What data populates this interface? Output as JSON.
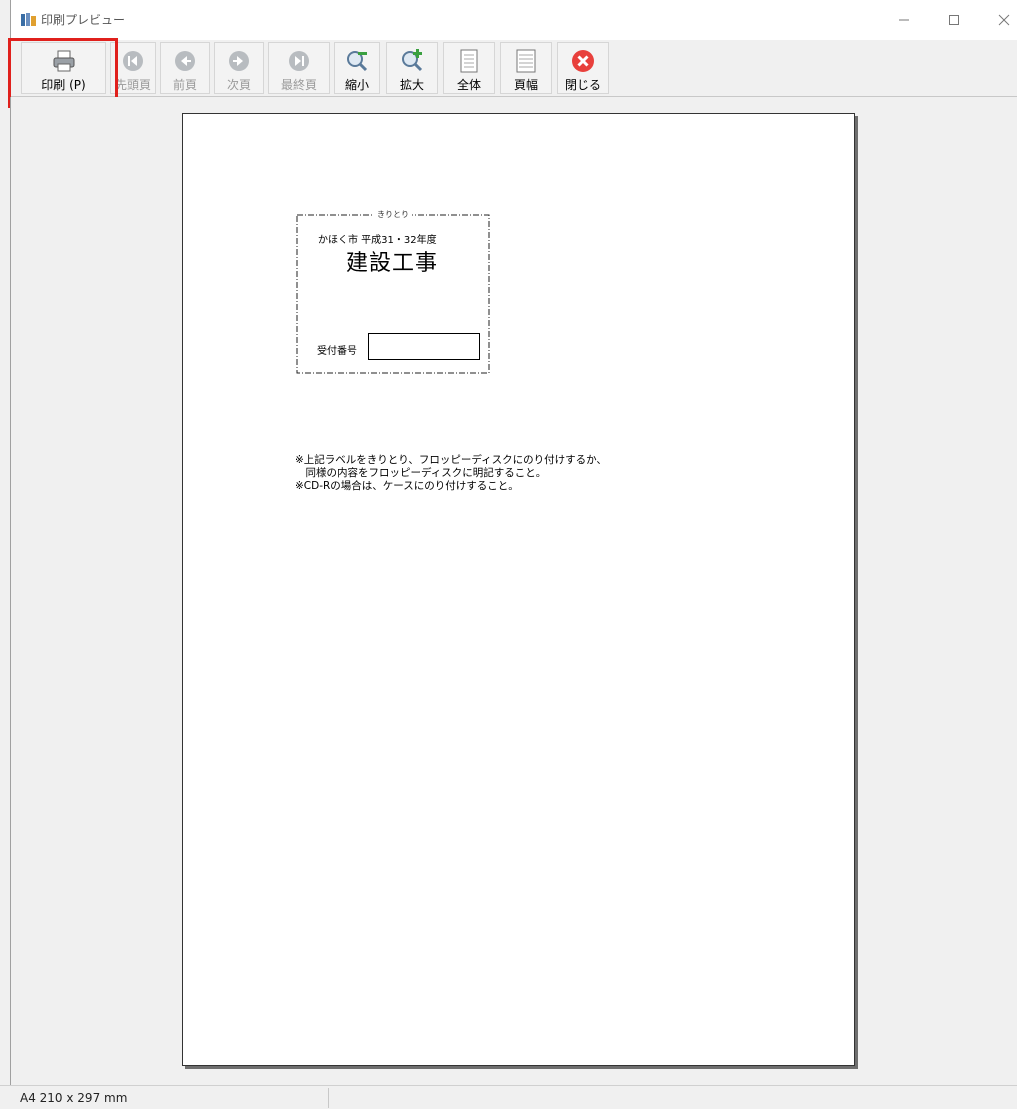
{
  "window": {
    "title": "印刷プレビュー"
  },
  "toolbar": {
    "buttons": [
      {
        "label": "印刷 (P)",
        "icon": "printer-icon",
        "enabled": true
      },
      {
        "label": "先頭頁",
        "icon": "first-page-icon",
        "enabled": false
      },
      {
        "label": "前頁",
        "icon": "prev-page-icon",
        "enabled": false
      },
      {
        "label": "次頁",
        "icon": "next-page-icon",
        "enabled": false
      },
      {
        "label": "最終頁",
        "icon": "last-page-icon",
        "enabled": false
      },
      {
        "label": "縮小",
        "icon": "zoom-out-icon",
        "enabled": true
      },
      {
        "label": "拡大",
        "icon": "zoom-in-icon",
        "enabled": true
      },
      {
        "label": "全体",
        "icon": "whole-page-icon",
        "enabled": true
      },
      {
        "label": "頁幅",
        "icon": "page-width-icon",
        "enabled": true
      },
      {
        "label": "閉じる",
        "icon": "close-red-icon",
        "enabled": true
      }
    ]
  },
  "page": {
    "cut_text": "きりとり",
    "city_line": "かほく市 平成31・32年度",
    "label_title": "建設工事",
    "receipt_label": "受付番号",
    "note": "※上記ラベルをきりとり、フロッピーディスクにのり付けするか、\n　同様の内容をフロッピーディスクに明記すること。\n※CD-Rの場合は、ケースにのり付けすること。"
  },
  "status": {
    "paper": "A4 210 x 297 mm"
  },
  "colors": {
    "highlight": "#e0201c",
    "close_button": "#e8403c"
  }
}
